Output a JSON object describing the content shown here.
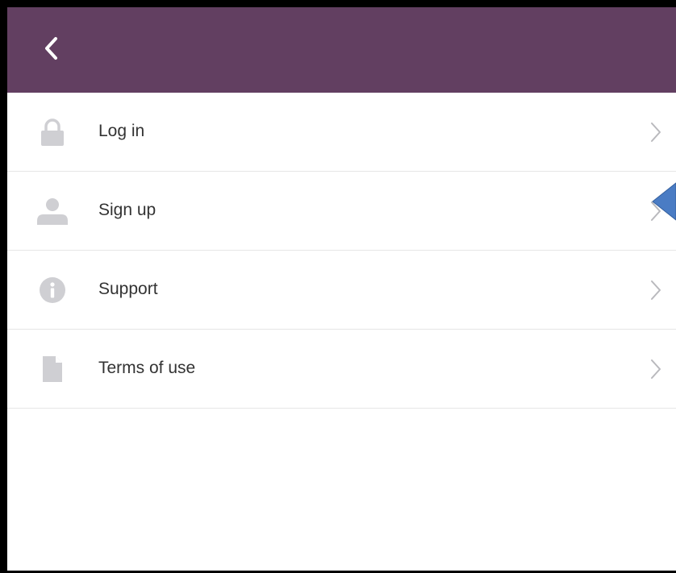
{
  "header": {
    "background_color": "#623f61",
    "back_icon": "chevron-left-icon"
  },
  "menu": {
    "items": [
      {
        "label": "Log in",
        "icon": "lock-icon"
      },
      {
        "label": "Sign up",
        "icon": "user-icon"
      },
      {
        "label": "Support",
        "icon": "info-icon"
      },
      {
        "label": "Terms of use",
        "icon": "document-icon"
      }
    ],
    "chevron_icon": "chevron-right-icon",
    "icon_color": "#cfcfd3",
    "chevron_color": "#b9b9bd"
  },
  "annotation": {
    "marker_color": "#4a7cc4"
  }
}
